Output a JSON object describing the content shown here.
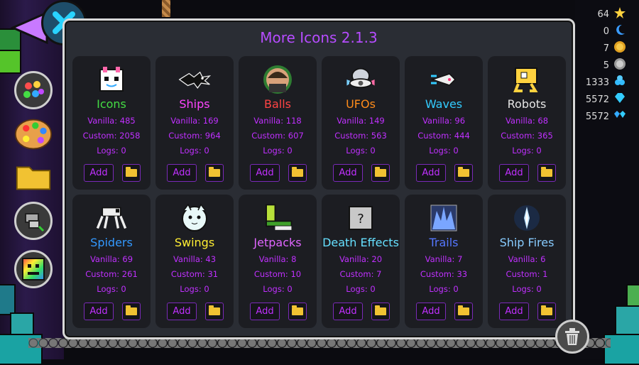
{
  "title": "More Icons 2.1.3",
  "stats": [
    {
      "value": "64",
      "icon": "star-icon"
    },
    {
      "value": "0",
      "icon": "moon-icon"
    },
    {
      "value": "7",
      "icon": "secret-coin-icon"
    },
    {
      "value": "5",
      "icon": "silver-coin-icon"
    },
    {
      "value": "1333",
      "icon": "orbs-icon"
    },
    {
      "value": "5572",
      "icon": "diamond-icon"
    },
    {
      "value": "5572",
      "icon": "diamond-shards-icon"
    }
  ],
  "buttons": {
    "add_label": "Add"
  },
  "categories": [
    {
      "name": "Icons",
      "color": "#44dd44",
      "vanilla": "Vanilla: 485",
      "custom": "Custom: 2058",
      "logs": "Logs: 0",
      "icon": "cube-icon"
    },
    {
      "name": "Ships",
      "color": "#ff44ff",
      "vanilla": "Vanilla: 169",
      "custom": "Custom: 964",
      "logs": "Logs: 0",
      "icon": "ship-icon"
    },
    {
      "name": "Balls",
      "color": "#ff4444",
      "vanilla": "Vanilla: 118",
      "custom": "Custom: 607",
      "logs": "Logs: 0",
      "icon": "ball-icon"
    },
    {
      "name": "UFOs",
      "color": "#ff8c1a",
      "vanilla": "Vanilla: 149",
      "custom": "Custom: 563",
      "logs": "Logs: 0",
      "icon": "ufo-icon"
    },
    {
      "name": "Waves",
      "color": "#33ccff",
      "vanilla": "Vanilla: 96",
      "custom": "Custom: 444",
      "logs": "Logs: 0",
      "icon": "wave-icon"
    },
    {
      "name": "Robots",
      "color": "#e6e6e6",
      "vanilla": "Vanilla: 68",
      "custom": "Custom: 365",
      "logs": "Logs: 0",
      "icon": "robot-icon"
    },
    {
      "name": "Spiders",
      "color": "#3399ff",
      "vanilla": "Vanilla: 69",
      "custom": "Custom: 261",
      "logs": "Logs: 0",
      "icon": "spider-icon"
    },
    {
      "name": "Swings",
      "color": "#ffee33",
      "vanilla": "Vanilla: 43",
      "custom": "Custom: 31",
      "logs": "Logs: 0",
      "icon": "swing-icon"
    },
    {
      "name": "Jetpacks",
      "color": "#e066ff",
      "vanilla": "Vanilla: 8",
      "custom": "Custom: 10",
      "logs": "Logs: 0",
      "icon": "jetpack-icon"
    },
    {
      "name": "Death Effects",
      "color": "#66e0ff",
      "vanilla": "Vanilla: 20",
      "custom": "Custom: 7",
      "logs": "Logs: 0",
      "icon": "death-effect-icon"
    },
    {
      "name": "Trails",
      "color": "#5577ff",
      "vanilla": "Vanilla: 7",
      "custom": "Custom: 33",
      "logs": "Logs: 0",
      "icon": "trail-icon"
    },
    {
      "name": "Ship Fires",
      "color": "#88ccff",
      "vanilla": "Vanilla: 6",
      "custom": "Custom: 1",
      "logs": "Logs: 0",
      "icon": "ship-fire-icon"
    }
  ]
}
